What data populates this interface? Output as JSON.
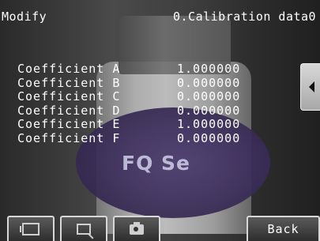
{
  "header": {
    "mode": "Modify",
    "section": "0.Calibration data0"
  },
  "image_overlay_text": "FQ Se",
  "coefficients": [
    {
      "name": "Coefficient A",
      "value": "1.000000"
    },
    {
      "name": "Coefficient B",
      "value": "0.000000"
    },
    {
      "name": "Coefficient C",
      "value": "0.000000"
    },
    {
      "name": "Coefficient D",
      "value": "0.000000"
    },
    {
      "name": "Coefficient E",
      "value": "1.000000"
    },
    {
      "name": "Coefficient F",
      "value": "0.000000"
    }
  ],
  "toolbar": {
    "frame_icon": "fit-frame-icon",
    "zoom_icon": "zoom-icon",
    "camera_icon": "camera-icon",
    "back_label": "Back"
  },
  "side_tab_icon": "chevron-left-icon"
}
